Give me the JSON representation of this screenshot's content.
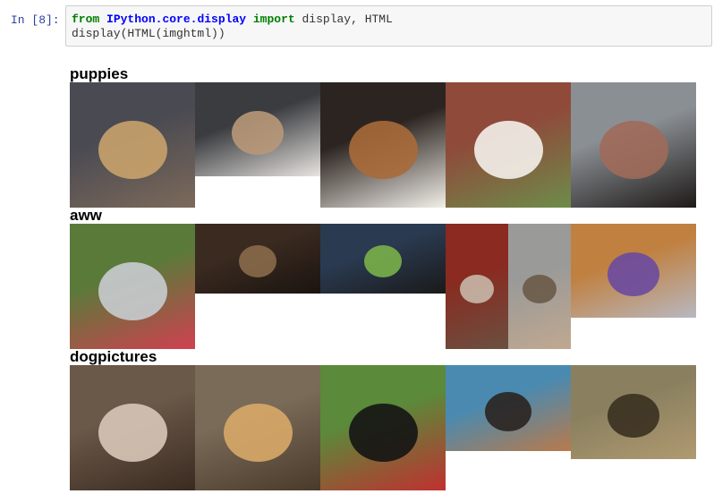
{
  "cell": {
    "prompt": "In [8]:",
    "code_line1_kw1": "from",
    "code_line1_module": "IPython.core.display",
    "code_line1_kw2": "import",
    "code_line1_rest": " display, HTML",
    "code_line2": "display(HTML(imghtml))"
  },
  "sections": [
    {
      "title": "puppies",
      "images": [
        {
          "alt": "group of golden puppies on floor",
          "colors": [
            "#4a4a52",
            "#c9a26b",
            "#7c6a5a"
          ]
        },
        {
          "alt": "four husky puppies",
          "colors": [
            "#3a3c40",
            "#b89878",
            "#e8e4e0"
          ]
        },
        {
          "alt": "brown and white puppy",
          "colors": [
            "#2c2420",
            "#a86a3a",
            "#f2efe9"
          ]
        },
        {
          "alt": "fluffy white puppy",
          "colors": [
            "#8f4a3a",
            "#f4f1eb",
            "#6d8c4a"
          ]
        },
        {
          "alt": "black puppy on brick path",
          "colors": [
            "#8a8f94",
            "#a06a5a",
            "#1e1a18"
          ]
        }
      ]
    },
    {
      "title": "aww",
      "images": [
        {
          "alt": "dog hiding behind wall with flowers",
          "colors": [
            "#5a7a3a",
            "#c8ccd0",
            "#d04050"
          ]
        },
        {
          "alt": "people at a bar",
          "colors": [
            "#3a2a20",
            "#8a6a4a",
            "#1a1410"
          ]
        },
        {
          "alt": "dog watching sports on tv",
          "colors": [
            "#2a3a50",
            "#7ab04a",
            "#1a1a1a"
          ]
        },
        {
          "alt": "small dog on rug",
          "colors": [
            "#8a2a20",
            "#c8b8a8",
            "#6a5040"
          ]
        },
        {
          "alt": "dog on leash outside",
          "colors": [
            "#9a9a98",
            "#6a5a48",
            "#c0a890"
          ]
        },
        {
          "alt": "purple toy on wooden floor",
          "colors": [
            "#c08040",
            "#6a4aa0",
            "#b8b8c0"
          ]
        }
      ]
    },
    {
      "title": "dogpictures",
      "images": [
        {
          "alt": "shar pei lying on couch",
          "colors": [
            "#6a5848",
            "#d8c8b8",
            "#3a2a20"
          ]
        },
        {
          "alt": "old golden retriever",
          "colors": [
            "#7a6a58",
            "#d8a868",
            "#4a3a2a"
          ]
        },
        {
          "alt": "black lab with flag bandana",
          "colors": [
            "#5a8a3a",
            "#141414",
            "#c03030"
          ]
        },
        {
          "alt": "tricolor dog on wooden deck",
          "colors": [
            "#4a8ab0",
            "#2a2420",
            "#b87a4a"
          ]
        },
        {
          "alt": "german shepherd in grass",
          "colors": [
            "#8a8060",
            "#3a3020",
            "#b09a70"
          ]
        }
      ]
    },
    {
      "title": "",
      "images": []
    }
  ]
}
